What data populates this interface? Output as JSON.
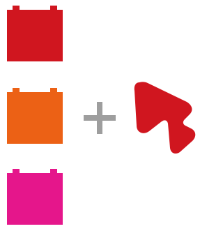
{
  "diagram": {
    "bricks": [
      {
        "name": "red",
        "color": "#d0161f"
      },
      {
        "name": "orange",
        "color": "#ec6115"
      },
      {
        "name": "pink",
        "color": "#e5168b"
      }
    ],
    "operator": {
      "icon": "plus-icon",
      "color": "#9e9e9e"
    },
    "result": {
      "icon": "play-arrow-logo-icon",
      "color": "#d0161f"
    }
  }
}
